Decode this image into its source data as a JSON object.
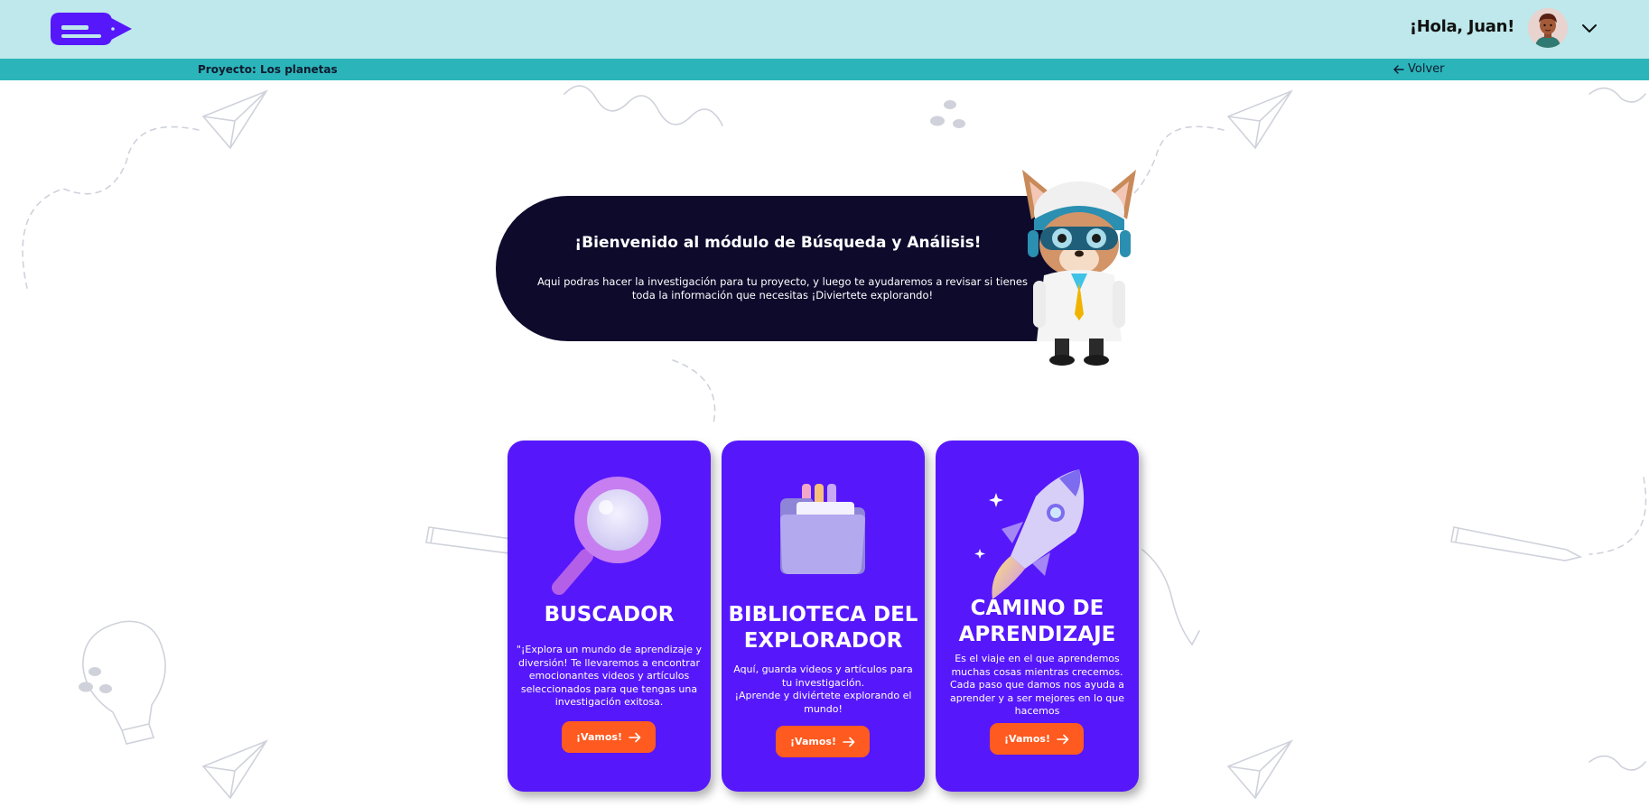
{
  "header": {
    "logo_icon": "ed-logo",
    "greeting": "¡Hola, Juan!",
    "menu_icon": "chevron-down-icon"
  },
  "project_bar": {
    "project_label": "Proyecto: Los planetas",
    "back_label": "Volver"
  },
  "welcome": {
    "title": "¡Bienvenido al módulo de Búsqueda y Análisis!",
    "text": "Aqui podras hacer la investigación para tu proyecto, y luego te ayudaremos a revisar si tienes toda la información que necesitas ¡Diviertete explorando!"
  },
  "cards": [
    {
      "title": "BUSCADOR",
      "description": "\"¡Explora un mundo de aprendizaje y diversión! Te llevaremos a encontrar emocionantes videos y artículos seleccionados para que tengas una investigación exitosa.",
      "button": "¡Vamos!",
      "icon": "magnifier-icon"
    },
    {
      "title": "BIBLIOTECA DEL EXPLORADOR",
      "description": "Aquí, guarda videos y artículos para tu investigación.\n¡Aprende y diviértete explorando el mundo!",
      "button": "¡Vamos!",
      "icon": "folder-icon"
    },
    {
      "title": "CAMINO DE APRENDIZAJE",
      "description": "Es el viaje en el que aprendemos muchas cosas mientras crecemos.\nCada paso que damos nos ayuda a aprender y a ser mejores en lo que hacemos",
      "button": "¡Vamos!",
      "icon": "rocket-icon"
    }
  ],
  "colors": {
    "header_bg": "#bee8eb",
    "project_bar_bg": "#2bb5ba",
    "brand_purple": "#5618fb",
    "welcome_bg": "#0d0a2c",
    "button_orange": "#ff5a1f"
  }
}
